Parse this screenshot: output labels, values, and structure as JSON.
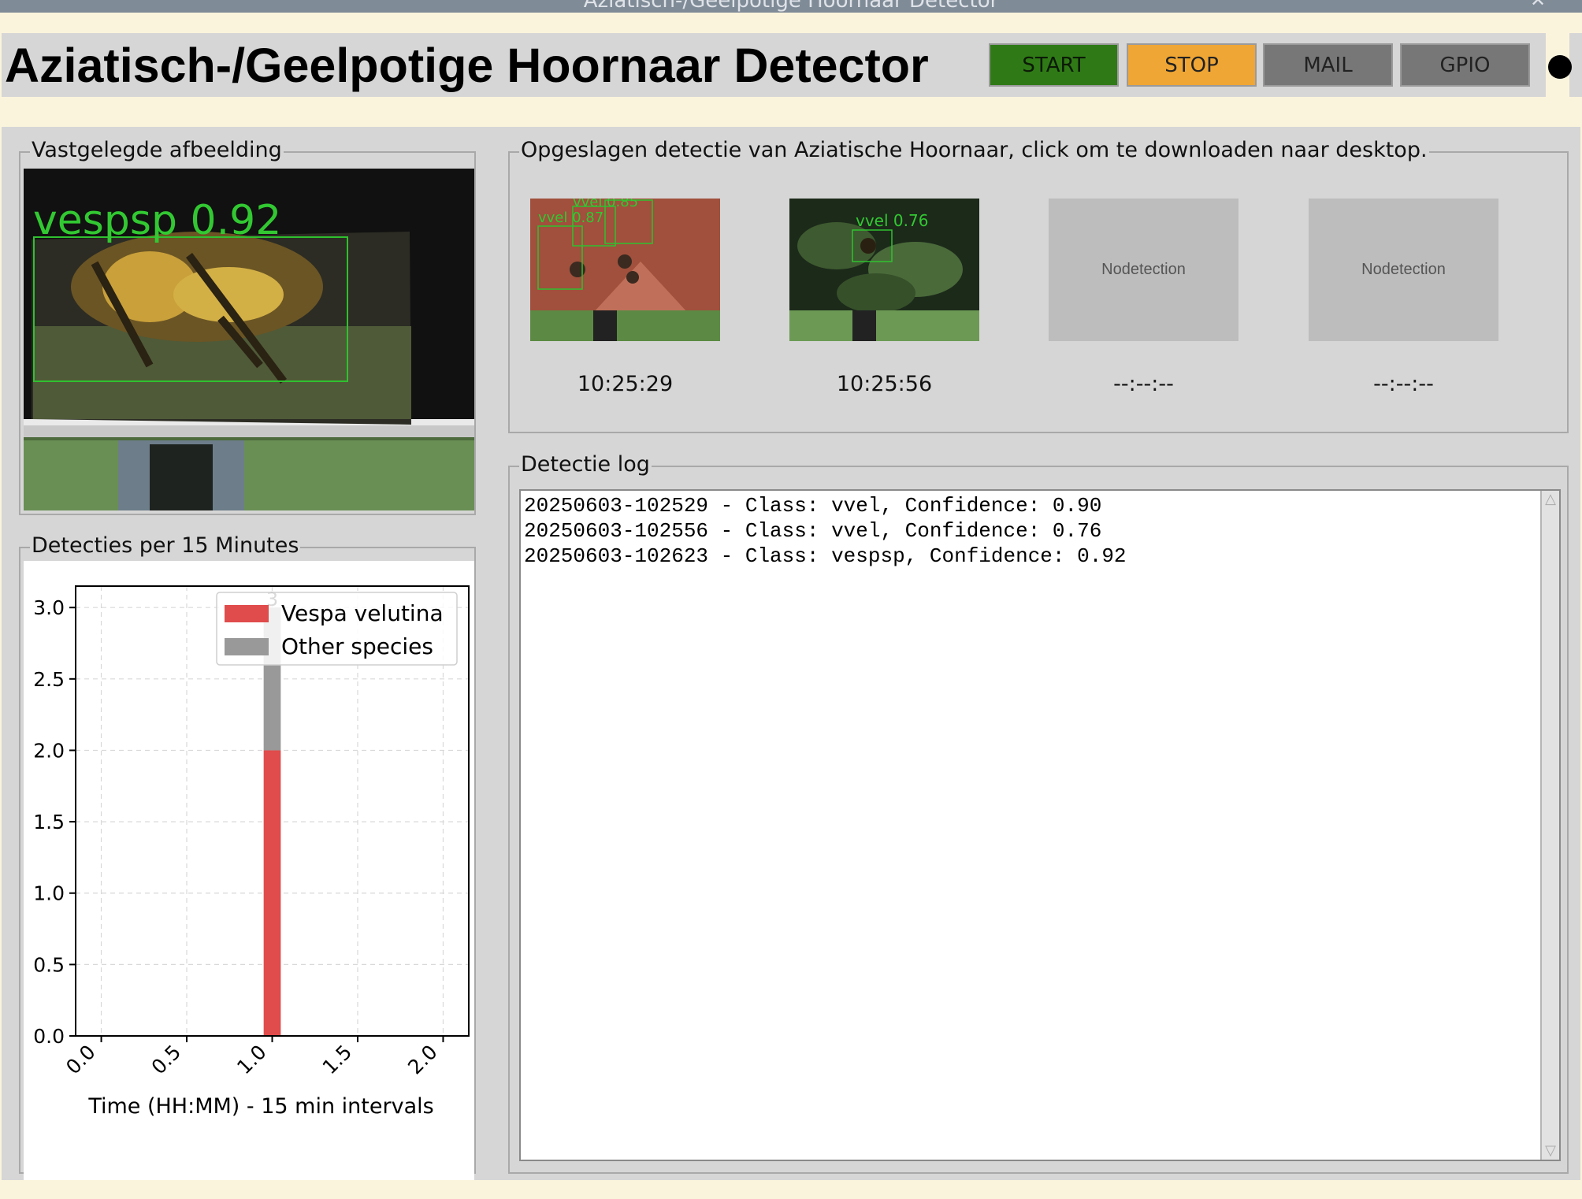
{
  "window": {
    "title": "Aziatisch-/Geelpotige Hoornaar Detector",
    "controls": [
      "⌃",
      "✕"
    ]
  },
  "header": {
    "title": "Aziatisch-/Geelpotige Hoornaar Detector",
    "buttons": {
      "start": "START",
      "stop": "STOP",
      "mail": "MAIL",
      "gpio": "GPIO"
    },
    "colors": {
      "start": "#2f7a16",
      "stop": "#efa634",
      "mail": "#777777",
      "gpio": "#777777"
    }
  },
  "captured": {
    "legend": "Vastgelegde afbeelding",
    "overlay_label": "vespsp 0.92"
  },
  "saved": {
    "legend": "Opgeslagen detectie van Aziatische Hoornaar, click om te downloaden naar desktop.",
    "items": [
      {
        "time": "10:25:29",
        "labels": [
          "vvel 0.87",
          "vvel 0.85"
        ]
      },
      {
        "time": "10:25:56",
        "labels": [
          "vvel 0.76"
        ]
      },
      {
        "time": "--:--:--",
        "placeholder": "Nodetection"
      },
      {
        "time": "--:--:--",
        "placeholder": "Nodetection"
      }
    ]
  },
  "log": {
    "legend": "Detectie log",
    "lines": [
      "20250603-102529 - Class: vvel, Confidence: 0.90",
      "20250603-102556 - Class: vvel, Confidence: 0.76",
      "20250603-102623 - Class: vespsp, Confidence: 0.92"
    ]
  },
  "chart_panel": {
    "legend": "Detecties per 15 Minutes"
  },
  "chart_data": {
    "type": "bar",
    "stacked": true,
    "x": [
      1.0
    ],
    "series": [
      {
        "name": "Vespa velutina",
        "values": [
          2
        ],
        "color": "#e04b4b"
      },
      {
        "name": "Other species",
        "values": [
          1
        ],
        "color": "#999999"
      }
    ],
    "bar_label": "3",
    "xlabel": "Time (HH:MM) - 15 min intervals",
    "ylabel": "",
    "xlim": [
      -0.15,
      2.15
    ],
    "ylim": [
      0,
      3.15
    ],
    "xticks": [
      "0.0",
      "0.5",
      "1.0",
      "1.5",
      "2.0"
    ],
    "yticks": [
      "0.0",
      "0.5",
      "1.0",
      "1.5",
      "2.0",
      "2.5",
      "3.0"
    ],
    "grid": true,
    "legend_position": "upper right"
  }
}
